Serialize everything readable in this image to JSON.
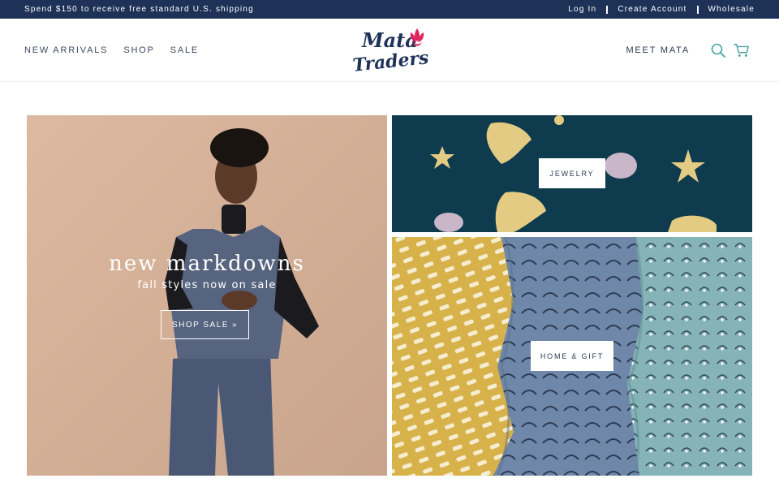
{
  "announcement": {
    "promo_text": "Spend $150 to receive free standard U.S. shipping",
    "links": [
      "Log In",
      "Create Account",
      "Wholesale"
    ]
  },
  "header": {
    "nav_left": [
      "NEW ARRIVALS",
      "SHOP",
      "SALE"
    ],
    "nav_right": "MEET MATA",
    "logo": {
      "line1": "Mata",
      "line2": "Traders",
      "icon": "lotus-flower-icon"
    },
    "icons": [
      "search-icon",
      "cart-icon"
    ]
  },
  "hero": {
    "title": "new markdowns",
    "subtitle": "fall styles now on sale",
    "button_label": "SHOP SALE",
    "button_icon": "»"
  },
  "tiles": {
    "jewelry_label": "JEWELRY",
    "home_label": "HOME & GIFT"
  },
  "colors": {
    "topbar": "#1e3258",
    "logo_navy": "#1e3258",
    "logo_accent": "#e0245e",
    "icon_teal": "#4aa3a8"
  }
}
